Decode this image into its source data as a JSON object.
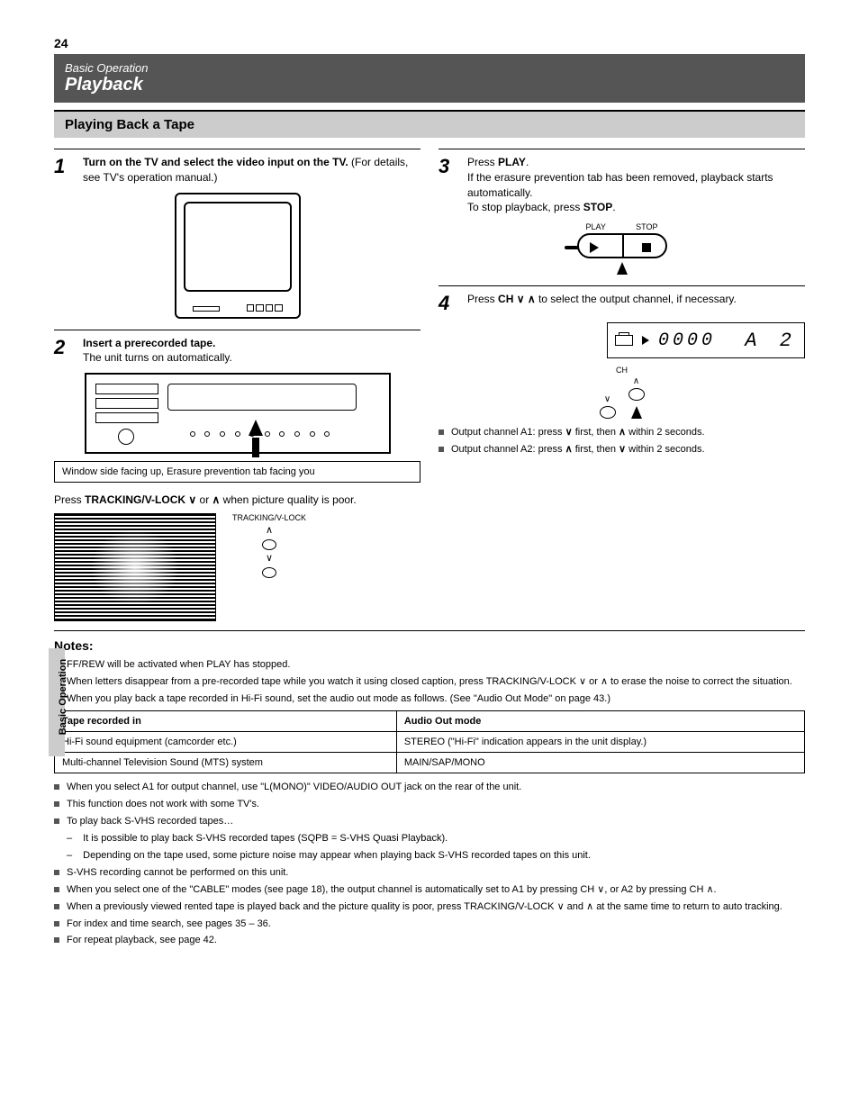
{
  "page_number": "24",
  "header_small": "Basic Operation",
  "header_big": "Playback",
  "subheader": "Playing Back a Tape",
  "side_tab": "Basic Operation",
  "step1": {
    "num": "1",
    "text_a": "Turn on the TV and select the video input on the TV.",
    "text_b": "(For details, see TV's operation manual.)"
  },
  "step2": {
    "num": "2",
    "text_a": "Insert a prerecorded tape.",
    "text_b": "The unit turns on automatically.",
    "caption": "Window side facing up, Erasure prevention tab facing you"
  },
  "step3": {
    "text_a": "Press",
    "key1": "TRACKING/V-LOCK",
    "or": "or",
    "text_c": "when picture quality is poor.",
    "label": "TRACKING/V-LOCK"
  },
  "step4": {
    "num": "3",
    "text_a": "Press",
    "key": "PLAY",
    "text_b": "If the erasure prevention tab has been removed, playback starts automatically.",
    "step4_text": "To stop playback, press",
    "stop_key": "STOP",
    "label_play": "PLAY",
    "label_stop": "STOP"
  },
  "step5": {
    "num": "4",
    "text_a": "Press",
    "key": "CH",
    "text_b": "to select the output channel, if necessary.",
    "label_ch": "CH",
    "lcd_digits": "0000",
    "lcd_ch": "A 2",
    "bullet1a": "Output channel A1: press ",
    "bullet1b": " first, then ",
    "bullet1c": " within 2 seconds.",
    "bullet2a": "Output channel A2: press ",
    "bullet2b": " first, then ",
    "bullet2c": " within 2 seconds."
  },
  "notes": {
    "title": "Notes:",
    "items": [
      "FF/REW will be activated when PLAY has stopped.",
      "When letters disappear from a pre-recorded tape while you watch it using closed caption, press TRACKING/V-LOCK ∨ or ∧ to erase the noise to correct the situation.",
      "When you play back a tape recorded in Hi-Fi sound, set the audio out mode as follows. (See \"Audio Out Mode\" on page 43.)"
    ],
    "table": {
      "h1": "Tape recorded in",
      "h2": "Audio Out mode",
      "r1a": "Hi-Fi sound equipment (camcorder etc.)",
      "r1b": "STEREO (\"Hi-Fi\" indication appears in the unit display.)",
      "r2a": "Multi-channel Television Sound (MTS) system",
      "r2b": "MAIN/SAP/MONO"
    },
    "items2": [
      "When you select A1 for output channel, use \"L(MONO)\" VIDEO/AUDIO OUT jack on the rear of the unit.",
      "This function does not work with some TV's.",
      "To play back S-VHS recorded tapes…"
    ],
    "sub2": [
      "It is possible to play back S-VHS recorded tapes (SQPB = S-VHS Quasi Playback).",
      "Depending on the tape used, some picture noise may appear when playing back S-VHS recorded tapes on this unit."
    ],
    "items3": [
      "S-VHS recording cannot be performed on this unit.",
      "When you select one of the \"CABLE\" modes (see page 18), the output channel is automatically set to A1 by pressing CH ∨, or A2 by pressing CH ∧.",
      "When a previously viewed rented tape is played back and the picture quality is poor, press TRACKING/V-LOCK ∨ and ∧ at the same time to return to auto tracking.",
      "For index and time search, see pages 35 – 36.",
      "For repeat playback, see page 42."
    ]
  }
}
